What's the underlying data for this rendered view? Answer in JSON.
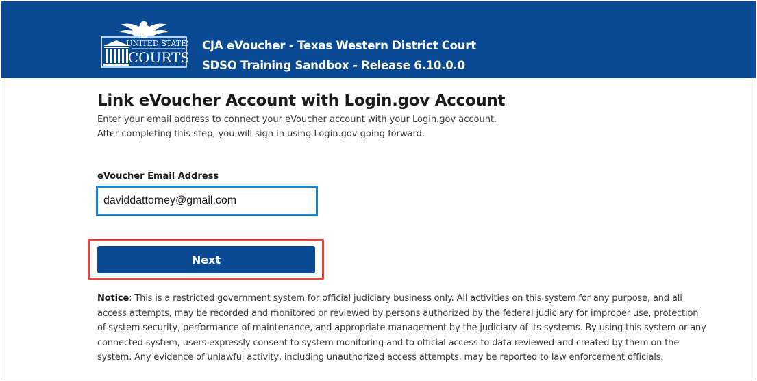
{
  "header": {
    "logo_text_top": "UNITED STATES",
    "logo_text_bottom": "COURTS",
    "title_line1": "CJA eVoucher - Texas Western District Court",
    "title_line2": "SDSO Training Sandbox - Release 6.10.0.0"
  },
  "main": {
    "page_title": "Link eVoucher Account with Login.gov Account",
    "intro_line1": "Enter your email address to connect your eVoucher account with your Login.gov account.",
    "intro_line2": "After completing this step, you will sign in using Login.gov going forward.",
    "email_label": "eVoucher Email Address",
    "email_value": "daviddattorney@gmail.com",
    "next_label": "Next",
    "notice_heading": "Notice",
    "notice_text": ": This is a restricted government system for official judiciary business only. All activities on this system for any purpose, and all access attempts, may be recorded and monitored or reviewed by persons authorized by the federal judiciary for improper use, protection of system security, performance of maintenance, and appropriate management by the judiciary of its systems. By using this system or any connected system, users expressly consent to system monitoring and to official access to data reviewed and created by them on the system. Any evidence of unlawful activity, including unauthorized access attempts, may be reported to law enforcement officials."
  },
  "colors": {
    "header_bg": "#0a4a94",
    "button_bg": "#0a4a94",
    "input_focus_border": "#1a86d8",
    "highlight_border": "#e0483f"
  },
  "icons": {
    "logo": "us-courts-eagle-logo"
  }
}
